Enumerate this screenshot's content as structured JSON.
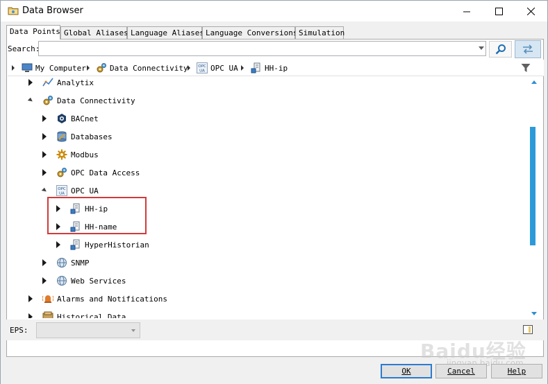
{
  "window": {
    "title": "Data Browser",
    "colors": {
      "accent": "#2d9ad8",
      "selection": "#fde3a7",
      "highlight": "#d23a3a"
    }
  },
  "tabs": [
    {
      "label": "Data Points",
      "active": true
    },
    {
      "label": "Global Aliases",
      "active": false
    },
    {
      "label": "Language Aliases",
      "active": false
    },
    {
      "label": "Language Conversions",
      "active": false
    },
    {
      "label": "Simulation",
      "active": false
    }
  ],
  "search": {
    "label": "Search:",
    "value": ""
  },
  "breadcrumb": [
    {
      "label": "My Computer",
      "icon": "computer-icon"
    },
    {
      "label": "Data Connectivity",
      "icon": "gears-icon"
    },
    {
      "label": "OPC UA",
      "icon": "opc-ua-icon"
    },
    {
      "label": "HH-ip",
      "icon": "server-node-icon"
    }
  ],
  "tree": [
    {
      "label": "Analytix",
      "icon": "analytics-icon",
      "level": 1,
      "expanded": false
    },
    {
      "label": "Data Connectivity",
      "icon": "gears-icon",
      "level": 1,
      "expanded": true
    },
    {
      "label": "BACnet",
      "icon": "bacnet-icon",
      "level": 2,
      "expanded": false
    },
    {
      "label": "Databases",
      "icon": "database-icon",
      "level": 2,
      "expanded": false
    },
    {
      "label": "Modbus",
      "icon": "modbus-icon",
      "level": 2,
      "expanded": false
    },
    {
      "label": "OPC Data Access",
      "icon": "gears-icon",
      "level": 2,
      "expanded": false
    },
    {
      "label": "OPC UA",
      "icon": "opc-ua-icon",
      "level": 2,
      "expanded": true
    },
    {
      "label": "HH-ip",
      "icon": "server-node-icon",
      "level": 3,
      "expanded": false,
      "selected": true
    },
    {
      "label": "HH-name",
      "icon": "server-node-icon",
      "level": 3,
      "expanded": false
    },
    {
      "label": "HyperHistorian",
      "icon": "server-node-icon",
      "level": 3,
      "expanded": false
    },
    {
      "label": "SNMP",
      "icon": "globe-icon",
      "level": 2,
      "expanded": false
    },
    {
      "label": "Web Services",
      "icon": "globe-icon",
      "level": 2,
      "expanded": false
    },
    {
      "label": "Alarms and Notifications",
      "icon": "alarm-icon",
      "level": 1,
      "expanded": false
    },
    {
      "label": "Historical Data",
      "icon": "history-icon",
      "level": 1,
      "expanded": false
    }
  ],
  "eps": {
    "label": "EPS:",
    "value": ""
  },
  "buttons": {
    "ok": "OK",
    "cancel": "Cancel",
    "help": "Help"
  },
  "watermark": {
    "brand": "Baidu经验",
    "sub": "jingyan.baidu.com"
  }
}
